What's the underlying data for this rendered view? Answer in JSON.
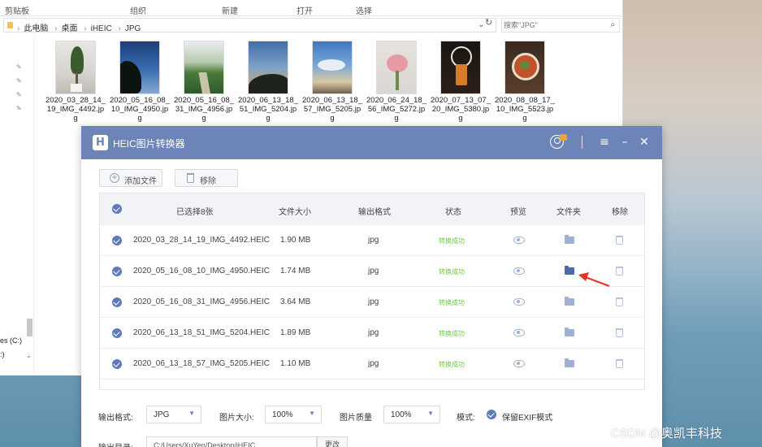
{
  "explorer": {
    "ribbon": [
      "剪贴板",
      "组织",
      "新建",
      "打开",
      "选择"
    ],
    "breadcrumb": [
      "此电脑",
      "桌面",
      "iHEIC",
      "JPG"
    ],
    "search_placeholder": "搜索\"JPG\"",
    "drives": [
      "es (C:)",
      ":)"
    ],
    "files": [
      {
        "name": "2020_03_28_14_19_IMG_4492.jpg",
        "icon": "photo-plant"
      },
      {
        "name": "2020_05_16_08_10_IMG_4950.jpg",
        "icon": "photo-sky-leaves"
      },
      {
        "name": "2020_05_16_08_31_IMG_4956.jpg",
        "icon": "photo-path"
      },
      {
        "name": "2020_06_13_18_51_IMG_5204.jpg",
        "icon": "photo-treeline"
      },
      {
        "name": "2020_06_13_18_57_IMG_5205.jpg",
        "icon": "photo-clouds"
      },
      {
        "name": "2020_06_24_18_56_IMG_5272.jpg",
        "icon": "photo-flowers"
      },
      {
        "name": "2020_07_13_07_20_IMG_5380.jpg",
        "icon": "photo-drink"
      },
      {
        "name": "2020_08_08_17_10_IMG_5523.jpg",
        "icon": "photo-food"
      }
    ]
  },
  "app": {
    "title": "HEIC图片转换器",
    "logo": "H",
    "add_file": "添加文件",
    "remove": "移除",
    "headers": {
      "selected": "已选择8张",
      "size": "文件大小",
      "format": "输出格式",
      "status": "状态",
      "preview": "预览",
      "folder": "文件夹",
      "remove": "移除"
    },
    "rows": [
      {
        "name": "2020_03_28_14_19_IMG_4492.HEIC",
        "size": "1.90 MB",
        "format": "jpg",
        "status": "转换成功"
      },
      {
        "name": "2020_05_16_08_10_IMG_4950.HEIC",
        "size": "1.74 MB",
        "format": "jpg",
        "status": "转换成功"
      },
      {
        "name": "2020_05_16_08_31_IMG_4956.HEIC",
        "size": "3.64 MB",
        "format": "jpg",
        "status": "转换成功"
      },
      {
        "name": "2020_06_13_18_51_IMG_5204.HEIC",
        "size": "1.89 MB",
        "format": "jpg",
        "status": "转换成功"
      },
      {
        "name": "2020_06_13_18_57_IMG_5205.HEIC",
        "size": "1.10 MB",
        "format": "jpg",
        "status": "转换成功"
      }
    ],
    "output_format_label": "输出格式:",
    "output_format": "JPG",
    "image_size_label": "图片大小:",
    "image_size": "100%",
    "image_quality_label": "图片质量",
    "image_quality": "100%",
    "mode_label": "模式:",
    "mode_value": "保留EXIF模式",
    "output_dir_label": "输出目录:",
    "output_dir": "C:/Users/XuYen/Desktop/iHEIC",
    "change_label": "更改"
  },
  "colors": {
    "accent": "#6d84b9",
    "success": "#6ccc3c",
    "annotation": "#e8322a"
  },
  "watermark": "CSDN @奥凯丰科技"
}
